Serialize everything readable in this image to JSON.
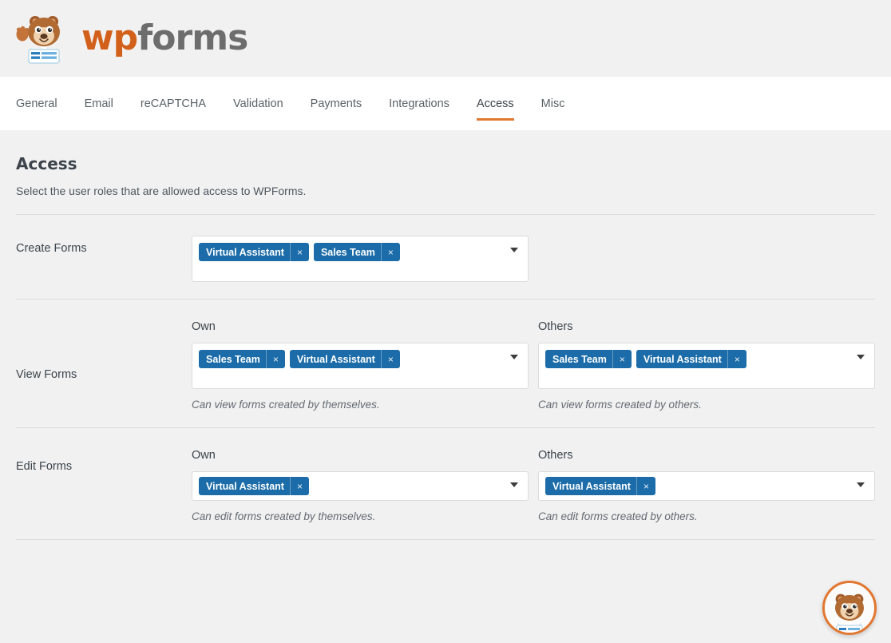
{
  "header": {
    "logo_alt": "wpforms-logo",
    "brand_wp": "wp",
    "brand_forms": "forms",
    "logo_orange": "#d2601a",
    "logo_grey": "#6d6d6d"
  },
  "nav": {
    "tabs": [
      {
        "label": "General",
        "active": false
      },
      {
        "label": "Email",
        "active": false
      },
      {
        "label": "reCAPTCHA",
        "active": false
      },
      {
        "label": "Validation",
        "active": false
      },
      {
        "label": "Payments",
        "active": false
      },
      {
        "label": "Integrations",
        "active": false
      },
      {
        "label": "Access",
        "active": true
      },
      {
        "label": "Misc",
        "active": false
      }
    ],
    "active_color": "#e27730"
  },
  "page": {
    "title": "Access",
    "description": "Select the user roles that are allowed access to WPForms."
  },
  "settings": {
    "tag_color": "#1b6ca8",
    "remove_icon": "×",
    "caret_icon": "chevron-down-icon",
    "rows": [
      {
        "label": "Create Forms",
        "columns": [
          {
            "heading": "",
            "tags": [
              "Virtual Assistant",
              "Sales Team"
            ],
            "help": ""
          }
        ]
      },
      {
        "label": "View Forms",
        "columns": [
          {
            "heading": "Own",
            "tags": [
              "Sales Team",
              "Virtual Assistant"
            ],
            "help": "Can view forms created by themselves."
          },
          {
            "heading": "Others",
            "tags": [
              "Sales Team",
              "Virtual Assistant"
            ],
            "help": "Can view forms created by others."
          }
        ]
      },
      {
        "label": "Edit Forms",
        "columns": [
          {
            "heading": "Own",
            "tags": [
              "Virtual Assistant"
            ],
            "help": "Can edit forms created by themselves."
          },
          {
            "heading": "Others",
            "tags": [
              "Virtual Assistant"
            ],
            "help": "Can edit forms created by others."
          }
        ]
      }
    ]
  },
  "help_widget": {
    "name": "wpforms-help-bear-button"
  }
}
